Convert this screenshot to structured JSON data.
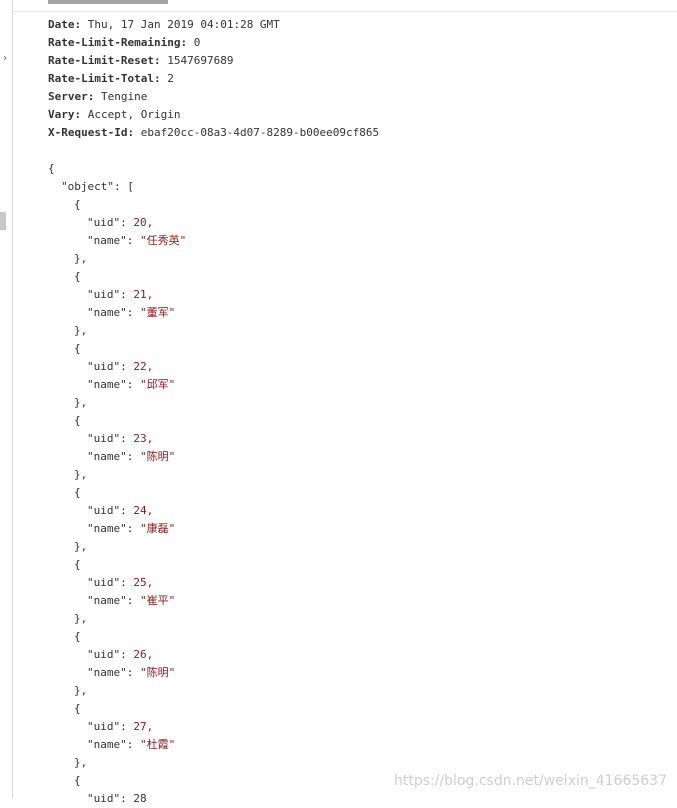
{
  "headers": [
    {
      "key": "Date:",
      "value": "Thu, 17 Jan 2019 04:01:28 GMT"
    },
    {
      "key": "Rate-Limit-Remaining:",
      "value": "0"
    },
    {
      "key": "Rate-Limit-Reset:",
      "value": "1547697689"
    },
    {
      "key": "Rate-Limit-Total:",
      "value": "2"
    },
    {
      "key": "Server:",
      "value": "Tengine"
    },
    {
      "key": "Vary:",
      "value": "Accept, Origin"
    },
    {
      "key": "X-Request-Id:",
      "value": "ebaf20cc-08a3-4d07-8289-b00ee09cf865"
    }
  ],
  "json": {
    "root_open": "{",
    "array_key": "\"object\": [",
    "item_open": "{",
    "item_close": "},",
    "uid_key": "\"uid\": ",
    "name_key": "\"name\": ",
    "items": [
      {
        "uid": "20,",
        "name": "\"任秀英\""
      },
      {
        "uid": "21,",
        "name": "\"董军\""
      },
      {
        "uid": "22,",
        "name": "\"邱军\""
      },
      {
        "uid": "23,",
        "name": "\"陈明\""
      },
      {
        "uid": "24,",
        "name": "\"康磊\""
      },
      {
        "uid": "25,",
        "name": "\"崔平\""
      },
      {
        "uid": "26,",
        "name": "\"陈明\""
      },
      {
        "uid": "27,",
        "name": "\"杜霞\""
      }
    ],
    "partial_uid_key": "\"uid\": 28"
  },
  "watermark": "https://blog.csdn.net/weixin_41665637"
}
